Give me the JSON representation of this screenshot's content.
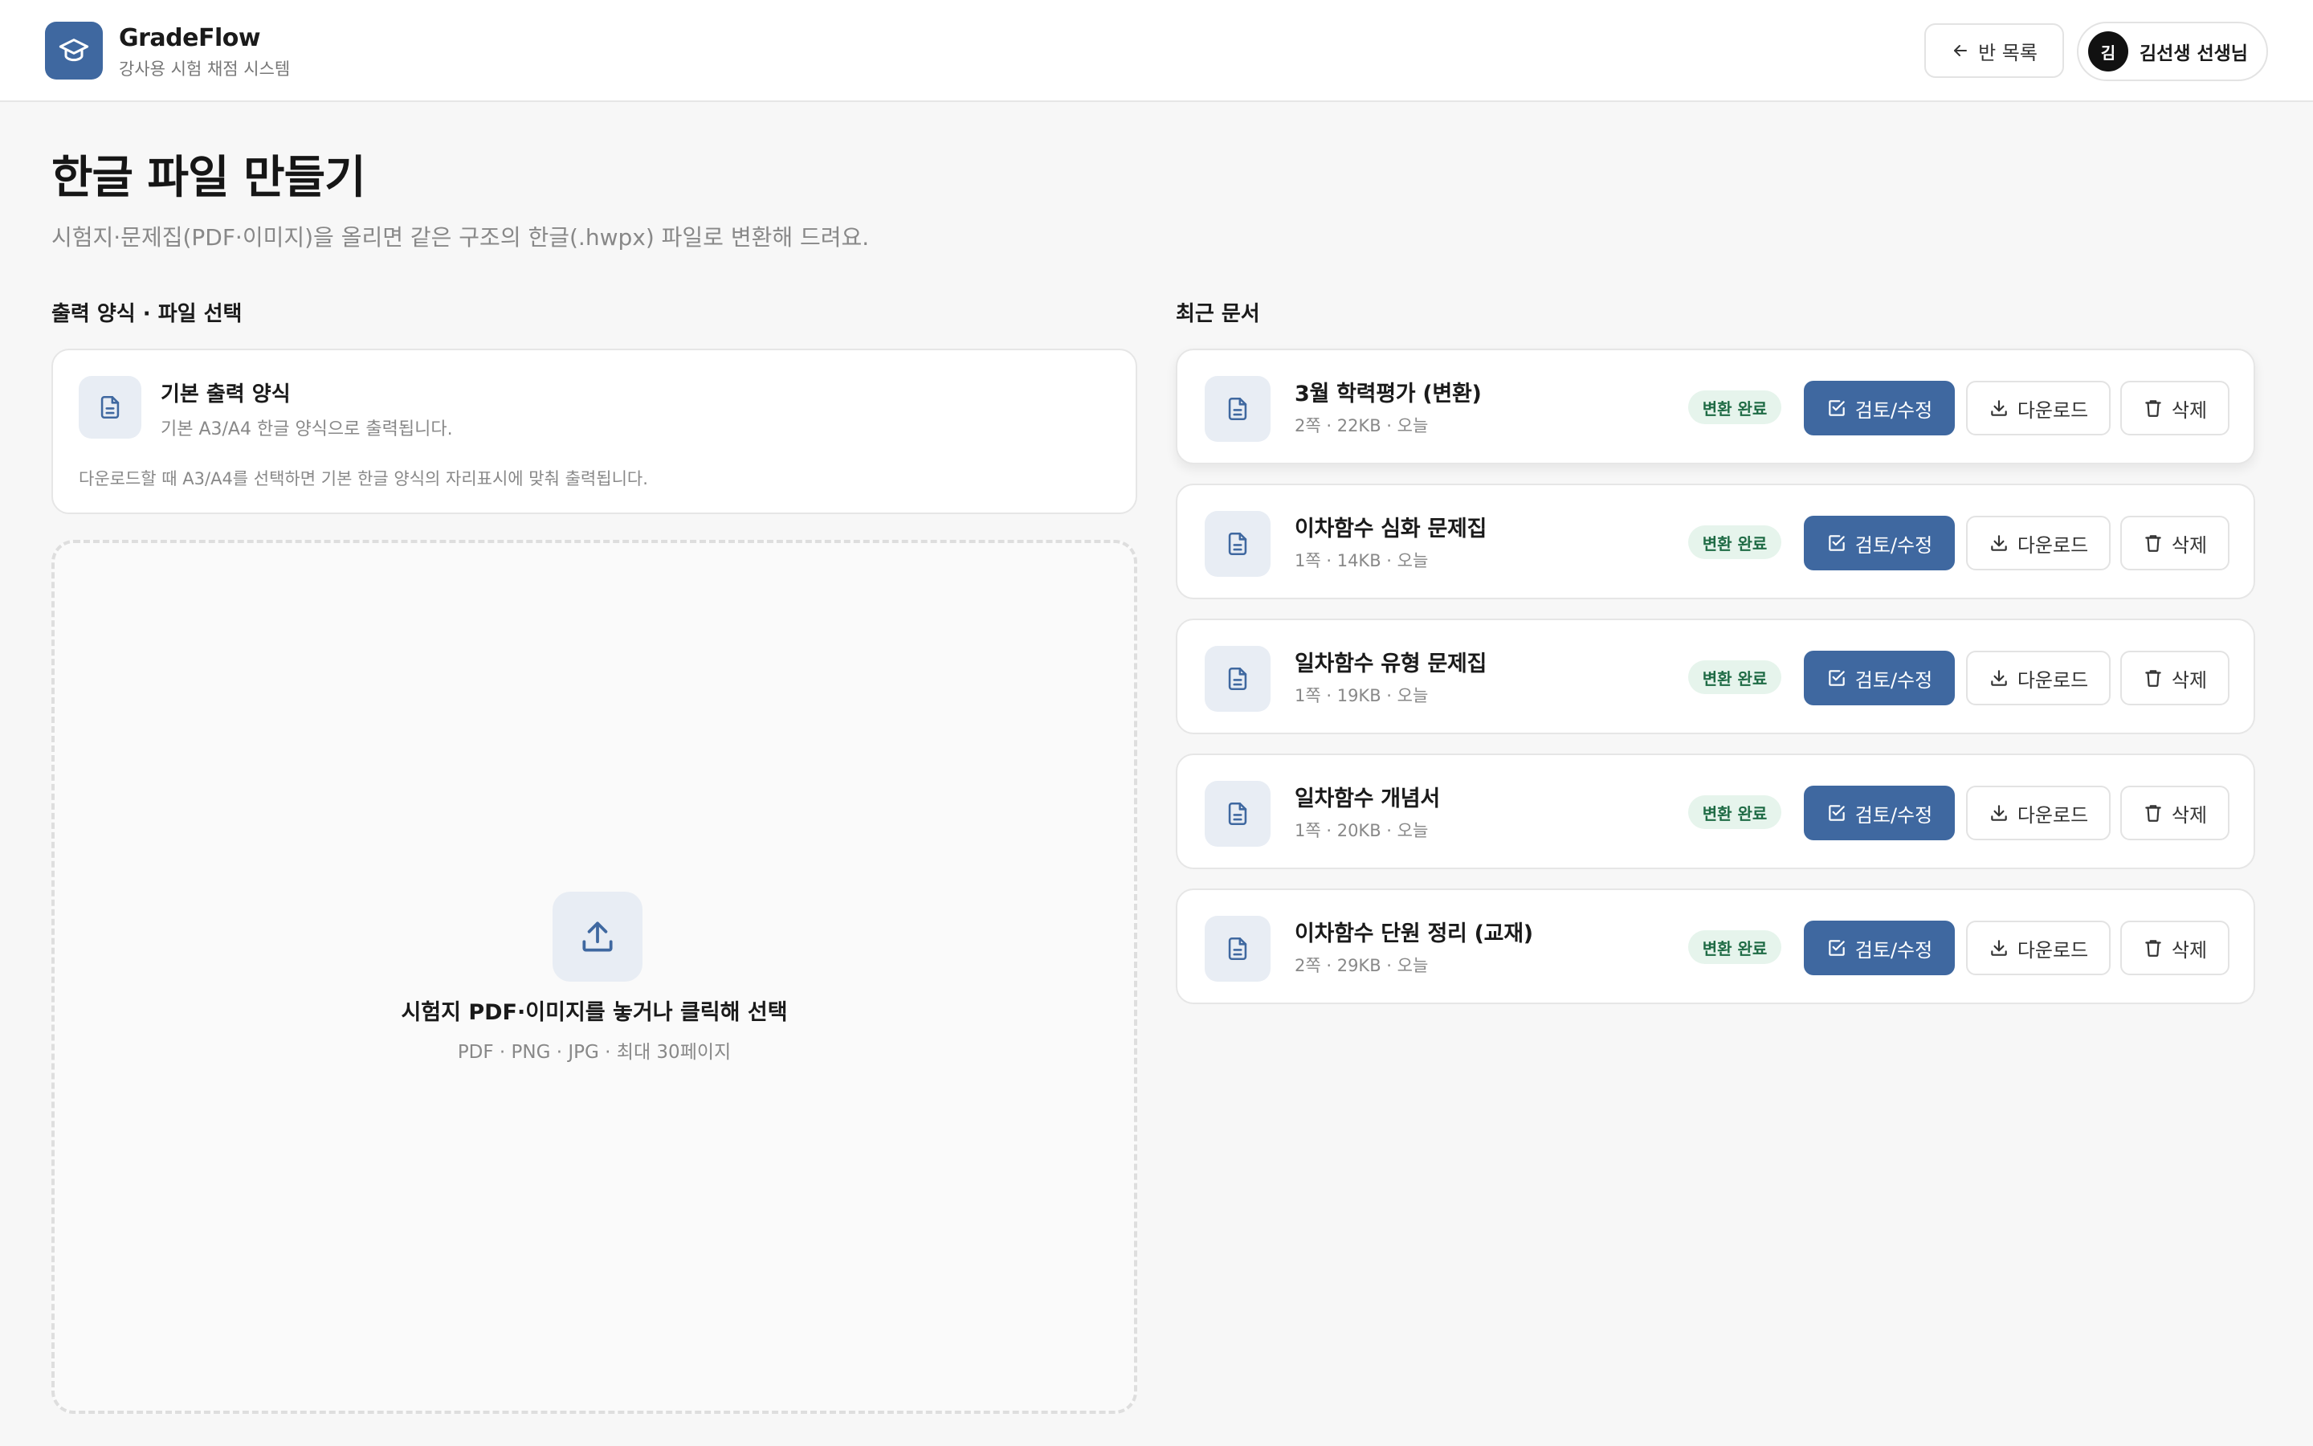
{
  "app": {
    "name": "GradeFlow",
    "subtitle": "강사용 시험 채점 시스템"
  },
  "header": {
    "back_label": "반 목록",
    "user_initial": "김",
    "user_name": "김선생 선생님"
  },
  "page": {
    "title": "한글 파일 만들기",
    "description": "시험지·문제집(PDF·이미지)을 올리면 같은 구조의 한글(.hwpx) 파일로 변환해 드려요."
  },
  "left": {
    "section_title": "출력 양식 · 파일 선택",
    "format_card": {
      "title": "기본 출력 양식",
      "description": "기본 A3/A4 한글 양식으로 출력됩니다.",
      "note": "다운로드할 때 A3/A4를 선택하면 기본 한글 양식의 자리표시에 맞춰 출력됩니다."
    },
    "dropzone": {
      "title": "시험지 PDF·이미지를 놓거나 클릭해 선택",
      "subtitle": "PDF · PNG · JPG · 최대 30페이지"
    }
  },
  "right": {
    "section_title": "최근 문서",
    "docs": [
      {
        "name": "3월 학력평가 (변환)",
        "meta": "2쪽 · 22KB · 오늘",
        "status": "변환 완료",
        "review": "검토/수정",
        "download": "다운로드",
        "delete": "삭제"
      },
      {
        "name": "이차함수 심화 문제집",
        "meta": "1쪽 · 14KB · 오늘",
        "status": "변환 완료",
        "review": "검토/수정",
        "download": "다운로드",
        "delete": "삭제"
      },
      {
        "name": "일차함수 유형 문제집",
        "meta": "1쪽 · 19KB · 오늘",
        "status": "변환 완료",
        "review": "검토/수정",
        "download": "다운로드",
        "delete": "삭제"
      },
      {
        "name": "일차함수 개념서",
        "meta": "1쪽 · 20KB · 오늘",
        "status": "변환 완료",
        "review": "검토/수정",
        "download": "다운로드",
        "delete": "삭제"
      },
      {
        "name": "이차함수 단원 정리 (교재)",
        "meta": "2쪽 · 29KB · 오늘",
        "status": "변환 완료",
        "review": "검토/수정",
        "download": "다운로드",
        "delete": "삭제"
      }
    ]
  },
  "colors": {
    "accent": "#3f68a0",
    "badge_bg": "#e6f4ec",
    "badge_text": "#1f6b45"
  }
}
